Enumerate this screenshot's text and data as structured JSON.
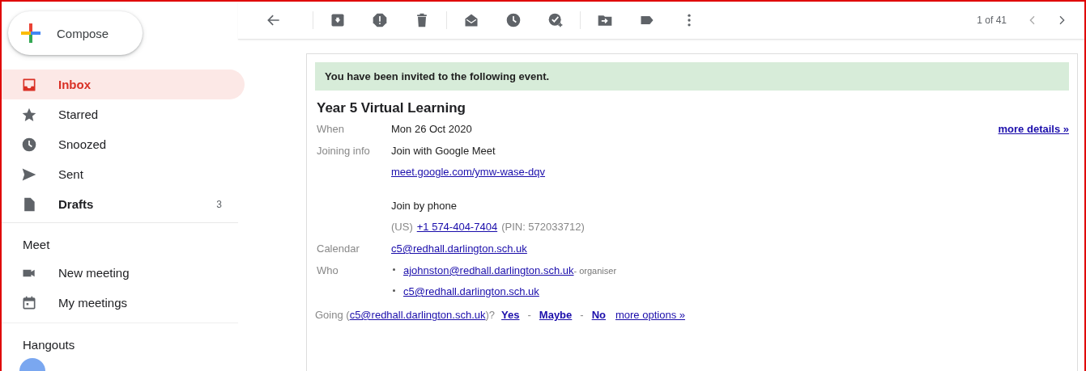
{
  "compose": {
    "label": "Compose"
  },
  "sidebar": {
    "items": [
      {
        "label": "Inbox",
        "selected": true,
        "unread": true
      },
      {
        "label": "Starred",
        "selected": false,
        "unread": false
      },
      {
        "label": "Snoozed",
        "selected": false,
        "unread": false
      },
      {
        "label": "Sent",
        "selected": false,
        "unread": false
      },
      {
        "label": "Drafts",
        "selected": false,
        "unread": true,
        "count": "3"
      }
    ]
  },
  "meet": {
    "heading": "Meet",
    "items": [
      {
        "label": "New meeting"
      },
      {
        "label": "My meetings"
      }
    ]
  },
  "hangouts": {
    "heading": "Hangouts"
  },
  "toolbar": {
    "pager": "1 of 41"
  },
  "invite": {
    "banner": "You have been invited to the following event.",
    "title": "Year 5 Virtual Learning",
    "more_details": "more details »",
    "when": {
      "label": "When",
      "value": "Mon 26 Oct 2020"
    },
    "joining": {
      "label": "Joining info",
      "meet_text": "Join with Google Meet",
      "meet_link": "meet.google.com/ymw-wase-dqv",
      "phone_heading": "Join by phone",
      "phone_prefix": "(US)",
      "phone_link": "+1 574-404-7404",
      "pin": "(PIN: 572033712)"
    },
    "calendar": {
      "label": "Calendar",
      "value": "c5@redhall.darlington.sch.uk"
    },
    "who": {
      "label": "Who",
      "people": [
        {
          "email": "ajohnston@redhall.darlington.sch.uk",
          "role": "- organiser"
        },
        {
          "email": "c5@redhall.darlington.sch.uk"
        }
      ]
    },
    "going": {
      "prefix": "Going (",
      "email": "c5@redhall.darlington.sch.uk",
      "suffix": ")?",
      "options": [
        "Yes",
        "Maybe",
        "No"
      ],
      "separator": "-",
      "more": "more options »"
    }
  }
}
